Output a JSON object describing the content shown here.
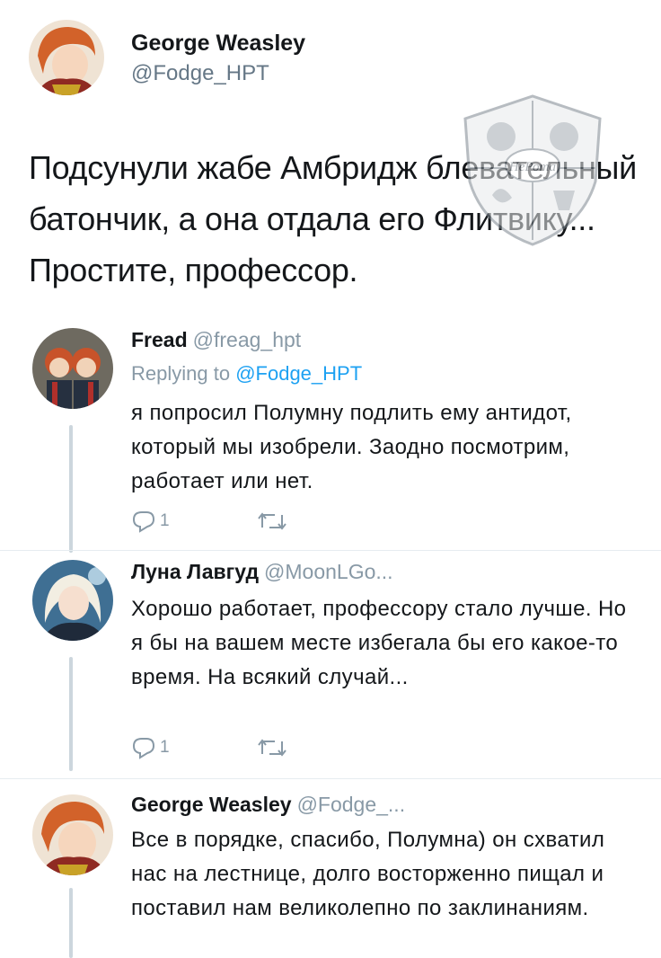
{
  "main_tweet": {
    "name": "George Weasley",
    "handle": "@Fodge_HPT",
    "text": "Подсунули жабе Амбридж блевательный батончик, а она отдала его Флитвику... Простите, профессор."
  },
  "watermark": {
    "text": "НеРота"
  },
  "replies": [
    {
      "name": "Fread",
      "handle": "@freag_hpt",
      "replying_prefix": "Replying to",
      "replying_to": "@Fodge_HPT",
      "text": "я попросил Полумну подлить ему антидот, который мы изобрели. Заодно посмотрим, работает или нет.",
      "reply_count": "1"
    },
    {
      "name": "Луна Лавгуд",
      "handle": "@MoonLGo...",
      "text": "Хорошо работает, профессору стало лучше. Но я бы на вашем месте избегала бы его какое-то время. На всякий случай...",
      "reply_count": "1"
    },
    {
      "name": "George Weasley",
      "handle": "@Fodge_...",
      "text": "Все в порядке, спасибо, Полумна) он схватил нас на лестнице, долго восторженно пищал и поставил нам великолепно по заклинаниям."
    }
  ],
  "colors": {
    "text": "#14171a",
    "muted": "#8899a6",
    "link": "#1da1f2",
    "thread_line": "#ccd6dd"
  },
  "icons": {
    "reply": "reply-icon",
    "retweet": "retweet-icon"
  }
}
